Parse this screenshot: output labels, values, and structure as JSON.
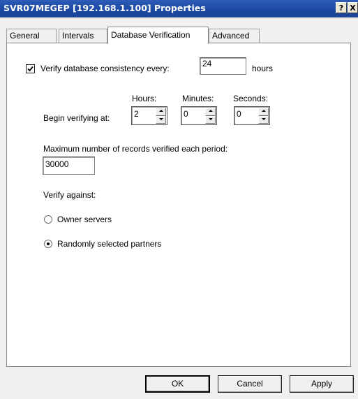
{
  "window": {
    "title": "SVR07MEGEP [192.168.1.100] Properties",
    "help_glyph": "?",
    "close_glyph": "X"
  },
  "tabs": [
    {
      "label": "General",
      "active": false
    },
    {
      "label": "Intervals",
      "active": false
    },
    {
      "label": "Database Verification",
      "active": true
    },
    {
      "label": "Advanced",
      "active": false
    }
  ],
  "verify": {
    "checkbox_label": "Verify database consistency every:",
    "checked": true,
    "interval_value": "24",
    "interval_unit": "hours"
  },
  "begin": {
    "label": "Begin verifying at:",
    "hours_label": "Hours:",
    "minutes_label": "Minutes:",
    "seconds_label": "Seconds:",
    "hours": "2",
    "minutes": "0",
    "seconds": "0"
  },
  "max_records": {
    "label": "Maximum number of records verified each period:",
    "value": "30000"
  },
  "verify_against": {
    "label": "Verify against:",
    "options": [
      {
        "label": "Owner servers",
        "selected": false
      },
      {
        "label": "Randomly selected partners",
        "selected": true
      }
    ]
  },
  "buttons": {
    "ok": "OK",
    "cancel": "Cancel",
    "apply": "Apply"
  }
}
